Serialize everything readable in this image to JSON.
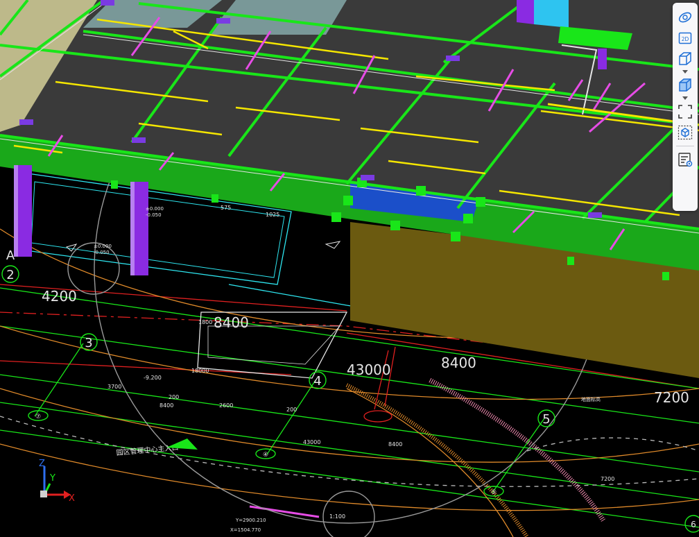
{
  "toolbar": {
    "items": [
      {
        "name": "orbit",
        "icon": "orbit-icon"
      },
      {
        "name": "view-2d",
        "icon": "view-2d-icon",
        "label": "2D"
      },
      {
        "name": "wireframe-view",
        "icon": "wireframe-cube-icon"
      },
      {
        "name": "solid-view",
        "icon": "solid-cube-icon"
      },
      {
        "name": "fit-frame",
        "icon": "frame-corners-icon"
      },
      {
        "name": "section-box",
        "icon": "section-box-icon"
      },
      {
        "name": "properties",
        "icon": "properties-panel-icon"
      }
    ],
    "accent": "#1e6fd6"
  },
  "axis_labels": {
    "grid": [
      "A",
      "2",
      "3",
      "4",
      "5",
      "6"
    ],
    "circled": [
      "⑦",
      "④",
      "⑤"
    ]
  },
  "dimensions": {
    "d4200": "4200",
    "d8400a": "8400",
    "d43000": "43000",
    "d8400b": "8400",
    "d7200": "7200",
    "d1800": "1800",
    "d18000": "18000",
    "d3700": "3700",
    "d2600": "2600",
    "d200": "200",
    "d8400s": "8400",
    "d43000s": "43000",
    "d7200s": "7200",
    "d8400t": "8400",
    "d1100": "1:100",
    "d575": "575",
    "d1025": "1025",
    "d9200": "-9.200",
    "d200b": "200"
  },
  "annotations": {
    "entrance": "园区管理中心主入口",
    "elev1": "±0.000",
    "elev2": "-0.050",
    "elev3": "±0.000",
    "elev4": "-0.050",
    "elev5": "地面标高",
    "coord1": "X=1504.770",
    "coord2": "Y=2900.210"
  },
  "triad": {
    "z": "Z",
    "y": "Y",
    "x": "X"
  },
  "colors": {
    "beam": "#19e619",
    "column": "#8a2be2",
    "slab": "#3a3a3a",
    "grid_yellow": "#f5e600",
    "rebar_magenta": "#e64ce6",
    "wall_olive": "#6b5a10",
    "cad_red": "#e02020",
    "cad_orange": "#e08a2a",
    "cad_cyan": "#2ee6f0",
    "cad_white": "#e6e6e6"
  }
}
